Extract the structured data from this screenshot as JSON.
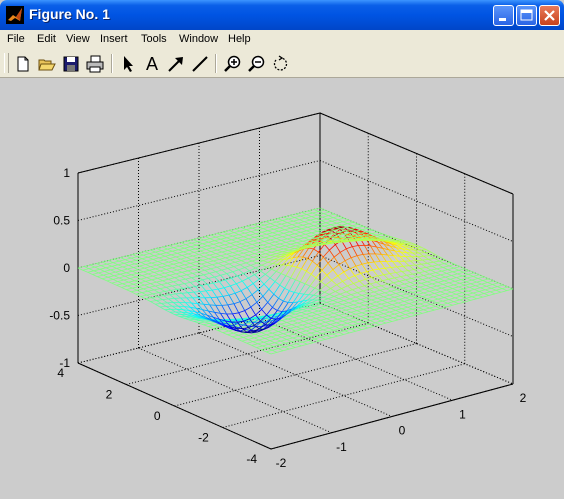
{
  "window": {
    "title": "Figure No. 1",
    "icon": "matlab-logo-icon"
  },
  "menubar": {
    "items": [
      "File",
      "Edit",
      "View",
      "Insert",
      "Tools",
      "Window",
      "Help"
    ]
  },
  "toolbar": {
    "tools": [
      "new-figure-icon",
      "open-file-icon",
      "save-icon",
      "print-icon",
      "select-arrow-icon",
      "insert-text-icon",
      "insert-arrow-icon",
      "insert-line-icon",
      "zoom-in-icon",
      "zoom-out-icon",
      "rotate-3d-icon"
    ],
    "text_tool_label": "A"
  },
  "chart_data": {
    "type": "surface",
    "function": "z = x * exp(-x^2 - y^2)",
    "style": "mesh",
    "colormap": "jet",
    "x_range": [
      -2,
      2
    ],
    "y_range": [
      -4,
      4
    ],
    "zlim": [
      -1,
      1
    ],
    "grid": true,
    "x_ticks": [
      "-2",
      "-1",
      "0",
      "1",
      "2"
    ],
    "y_ticks": [
      "-4",
      "-2",
      "0",
      "2",
      "4"
    ],
    "z_ticks": [
      "-1",
      "-0.5",
      "0",
      "0.5",
      "1"
    ],
    "peaks": {
      "max": 0.43,
      "min": -0.43
    }
  }
}
